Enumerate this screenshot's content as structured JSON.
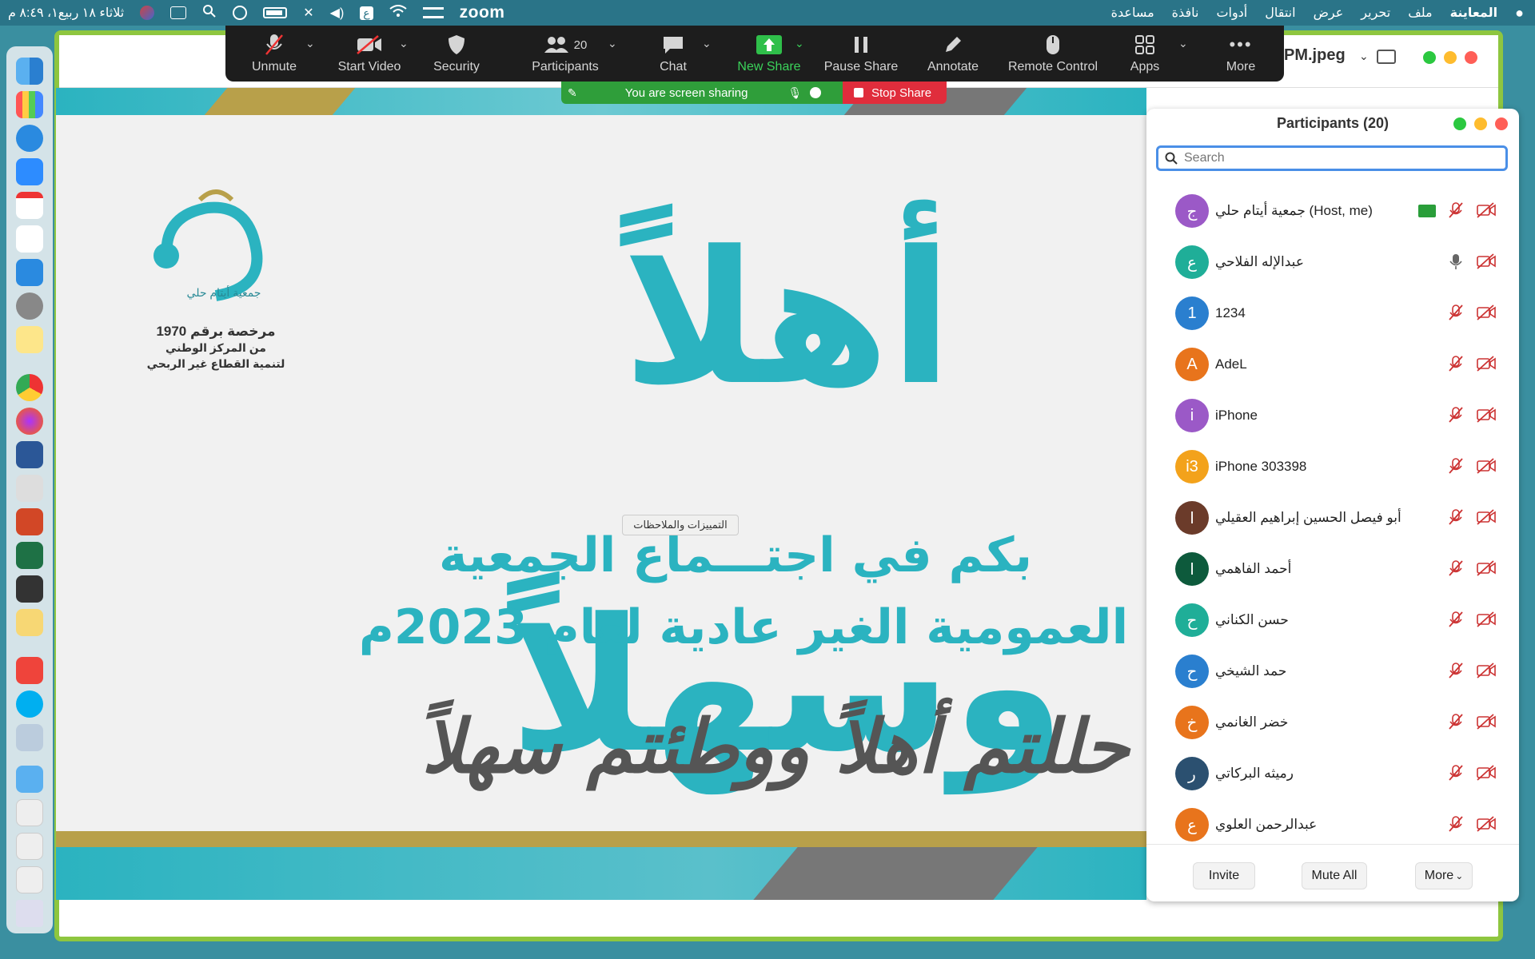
{
  "menubar": {
    "app_name": "المعاينة",
    "menus": [
      "ملف",
      "تحرير",
      "عرض",
      "انتقال",
      "أدوات",
      "نافذة",
      "مساعدة"
    ],
    "clock": "ثلاثاء ١٨ ربيع١، ٨:٤٩ م",
    "zoom_label": "zoom",
    "input_source": "ع"
  },
  "window": {
    "file_name": "PM.jpeg"
  },
  "toolbar": {
    "unmute": "Unmute",
    "start_video": "Start Video",
    "security": "Security",
    "participants": "Participants",
    "participants_count": "20",
    "chat": "Chat",
    "new_share": "New Share",
    "pause_share": "Pause Share",
    "annotate": "Annotate",
    "remote_control": "Remote Control",
    "apps": "Apps",
    "more": "More"
  },
  "share_banner": {
    "status": "You are screen sharing",
    "stop": "Stop Share"
  },
  "slide": {
    "title": "أهلاً وسهلاً",
    "line1": "بكم في اجتـــماع الجمعية",
    "line2": "العمومية الغير عادية لعام 2023م",
    "line3": "حللتم أهلاً ووطئتم سهلاً",
    "license_line1": "مرخصة برقم 1970",
    "license_line2": "من المركز الوطني",
    "license_line3": "لتنمية القطاع غير الربحي",
    "logo_text": "جمعية أيتام حلي",
    "tooltip": "التمييزات والملاحظات"
  },
  "participants_panel": {
    "title": "Participants (20)",
    "search_placeholder": "Search",
    "participants": [
      {
        "initial": "ج",
        "name": "جمعية أيتام حلي (Host, me)",
        "color": "#9b59c7",
        "sharing": true,
        "mic": "muted"
      },
      {
        "initial": "ع",
        "name": "عبدالإله الفلاحي",
        "color": "#1fae98",
        "sharing": false,
        "mic": "on"
      },
      {
        "initial": "1",
        "name": "1234",
        "color": "#2a7fcf",
        "sharing": false,
        "mic": "muted"
      },
      {
        "initial": "A",
        "name": "AdeL",
        "color": "#e8741c",
        "sharing": false,
        "mic": "muted"
      },
      {
        "initial": "i",
        "name": "iPhone",
        "color": "#9b59c7",
        "sharing": false,
        "mic": "muted"
      },
      {
        "initial": "i3",
        "name": "iPhone 303398",
        "color": "#f3a21b",
        "sharing": false,
        "mic": "muted"
      },
      {
        "initial": "ا",
        "name": "أبو فيصل الحسين إبراهيم العقيلي",
        "color": "#6b3b2a",
        "sharing": false,
        "mic": "muted"
      },
      {
        "initial": "ا",
        "name": "أحمد الفاهمي",
        "color": "#0d5a3c",
        "sharing": false,
        "mic": "muted"
      },
      {
        "initial": "ح",
        "name": "حسن الكناني",
        "color": "#1fae98",
        "sharing": false,
        "mic": "muted"
      },
      {
        "initial": "ح",
        "name": "حمد الشيخي",
        "color": "#2a7fcf",
        "sharing": false,
        "mic": "muted"
      },
      {
        "initial": "خ",
        "name": "خضر الغانمي",
        "color": "#e8741c",
        "sharing": false,
        "mic": "muted"
      },
      {
        "initial": "ر",
        "name": "رميثه البركاتي",
        "color": "#2b5070",
        "sharing": false,
        "mic": "muted"
      },
      {
        "initial": "ع",
        "name": "عبدالرحمن العلوي",
        "color": "#e8741c",
        "sharing": false,
        "mic": "muted"
      }
    ],
    "invite": "Invite",
    "mute_all": "Mute All",
    "more": "More"
  },
  "colors": {
    "teal": "#2bb3c0",
    "gold": "#b8a04a",
    "share_green": "#2f9e3a",
    "stop_red": "#e02d3c",
    "window_border_green": "#8ec63f"
  }
}
